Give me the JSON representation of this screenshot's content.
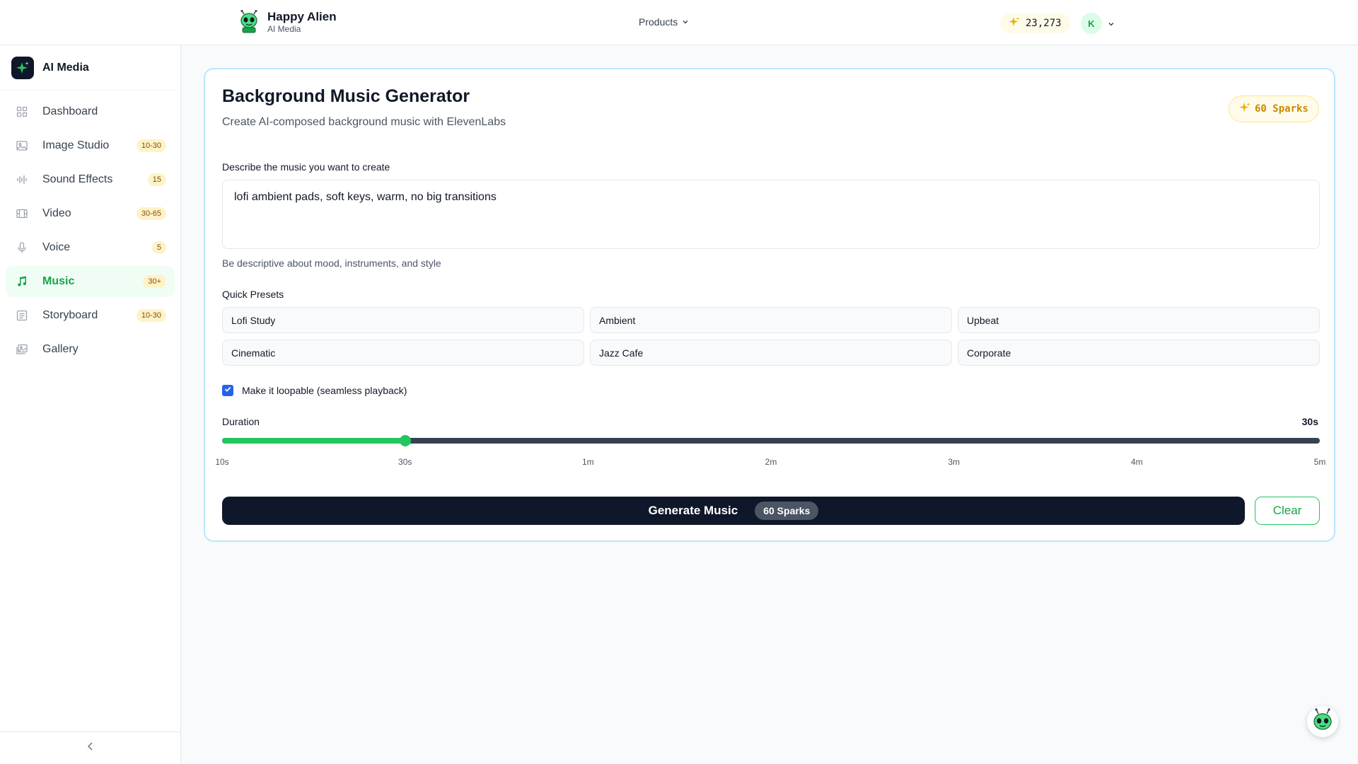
{
  "header": {
    "brand_name": "Happy Alien",
    "brand_sub": "AI Media",
    "products_label": "Products",
    "credits": "23,273",
    "avatar_initial": "K"
  },
  "sidebar": {
    "title": "AI Media",
    "items": [
      {
        "label": "Dashboard",
        "badge": "",
        "icon": "grid-icon"
      },
      {
        "label": "Image Studio",
        "badge": "10-30",
        "icon": "image-icon"
      },
      {
        "label": "Sound Effects",
        "badge": "15",
        "icon": "waveform-icon"
      },
      {
        "label": "Video",
        "badge": "30-65",
        "icon": "film-icon"
      },
      {
        "label": "Voice",
        "badge": "5",
        "icon": "microphone-icon"
      },
      {
        "label": "Music",
        "badge": "30+",
        "icon": "music-note-icon",
        "active": true
      },
      {
        "label": "Storyboard",
        "badge": "10-30",
        "icon": "storyboard-icon"
      },
      {
        "label": "Gallery",
        "badge": "",
        "icon": "gallery-icon"
      }
    ]
  },
  "main": {
    "title": "Background Music Generator",
    "subtitle": "Create AI-composed background music with ElevenLabs",
    "cost_pill": "60 Sparks",
    "prompt_label": "Describe the music you want to create",
    "prompt_value": "lofi ambient pads, soft keys, warm, no big transitions",
    "prompt_hint": "Be descriptive about mood, instruments, and style",
    "presets_label": "Quick Presets",
    "presets": [
      "Lofi Study",
      "Ambient",
      "Upbeat",
      "Cinematic",
      "Jazz Cafe",
      "Corporate"
    ],
    "loop_label": "Make it loopable (seamless playback)",
    "loop_checked": true,
    "duration_label": "Duration",
    "duration_value": "30s",
    "duration_seconds": 30,
    "duration_min_seconds": 10,
    "duration_max_seconds": 300,
    "ticks": [
      "10s",
      "30s",
      "1m",
      "2m",
      "3m",
      "4m",
      "5m"
    ],
    "generate_label": "Generate Music",
    "generate_cost": "60 Sparks",
    "clear_label": "Clear"
  },
  "colors": {
    "accent": "#22c55e",
    "dark": "#0f172a",
    "spark": "#ca8a04"
  }
}
